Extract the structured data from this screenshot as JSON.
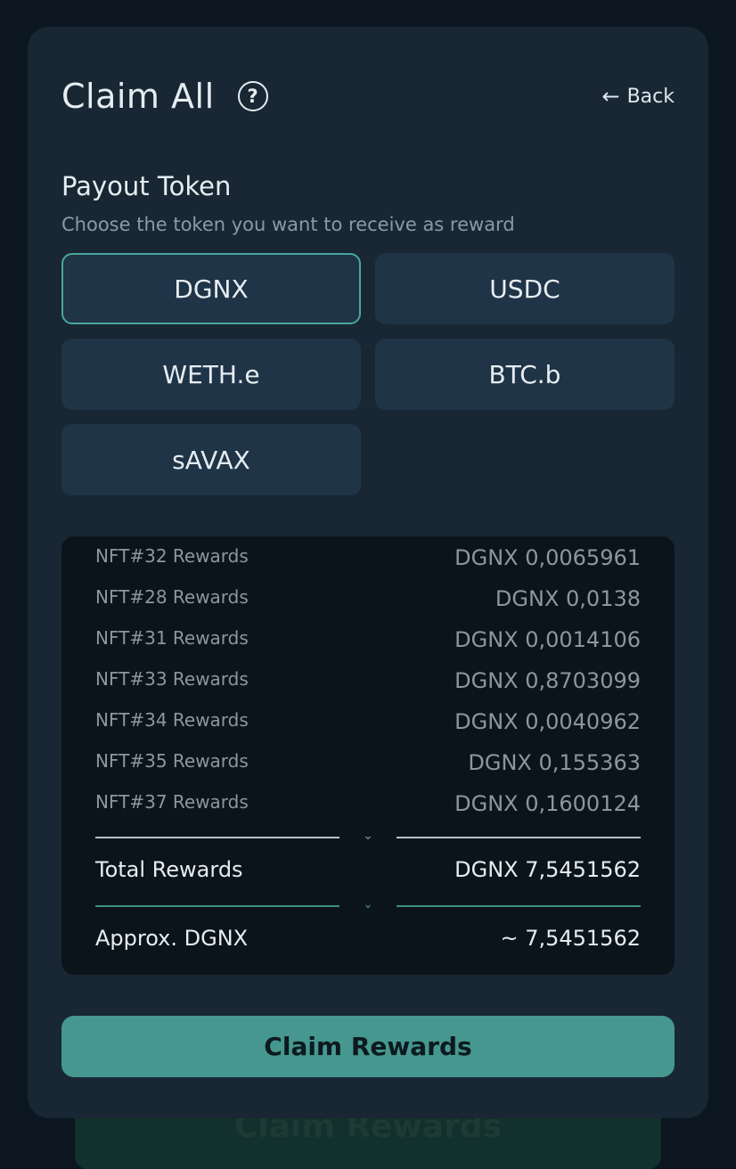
{
  "backdrop": {
    "claim_label": "Claim Rewards"
  },
  "modal": {
    "title": "Claim All",
    "help_icon": "question-circle-icon",
    "back_label": "Back",
    "back_icon": "arrow-left-icon"
  },
  "payout": {
    "title": "Payout Token",
    "subtitle": "Choose the token you want to receive as reward",
    "selected": "DGNX",
    "tokens": [
      "DGNX",
      "USDC",
      "WETH.e",
      "BTC.b",
      "sAVAX"
    ]
  },
  "rewards": {
    "items": [
      {
        "label": "NFT#32 Rewards",
        "value": "DGNX 0,0065961"
      },
      {
        "label": "NFT#28 Rewards",
        "value": "DGNX 0,0138"
      },
      {
        "label": "NFT#31 Rewards",
        "value": "DGNX 0,0014106"
      },
      {
        "label": "NFT#33 Rewards",
        "value": "DGNX 0,8703099"
      },
      {
        "label": "NFT#34 Rewards",
        "value": "DGNX 0,0040962"
      },
      {
        "label": "NFT#35 Rewards",
        "value": "DGNX 0,155363"
      },
      {
        "label": "NFT#37 Rewards",
        "value": "DGNX 0,1600124"
      }
    ],
    "total_label": "Total Rewards",
    "total_value": "DGNX 7,5451562",
    "approx_label": "Approx. DGNX",
    "approx_value": "~ 7,5451562"
  },
  "claim_button": {
    "label": "Claim Rewards"
  },
  "colors": {
    "accent": "#46978f",
    "selected_border": "#4aa79c",
    "panel": "#182733",
    "token_bg": "#203447"
  }
}
